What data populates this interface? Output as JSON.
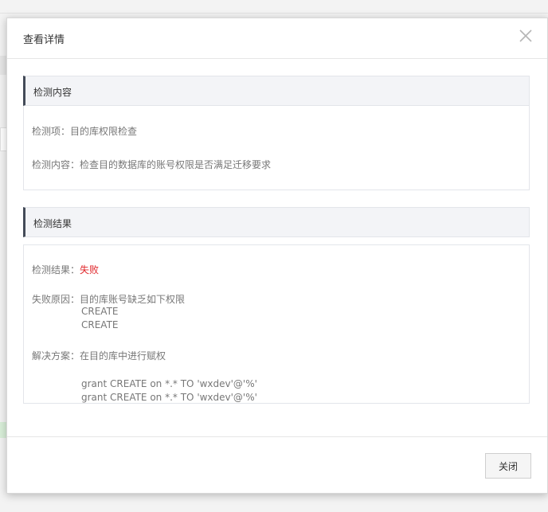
{
  "modal": {
    "title": "查看详情",
    "close_icon": "close-icon"
  },
  "check_content": {
    "heading": "检测内容",
    "item_label": "检测项：",
    "item_value": "目的库权限检查",
    "content_label": "检测内容：",
    "content_value": "检查目的数据库的账号权限是否满足迁移要求"
  },
  "check_result": {
    "heading": "检测结果",
    "result_label": "检测结果：",
    "result_value": "失败",
    "reason_label": "失败原因：",
    "reason_value": "目的库账号缺乏如下权限",
    "reason_items": [
      "CREATE",
      "CREATE"
    ],
    "solution_label": "解决方案：",
    "solution_value": "在目的库中进行赋权",
    "solution_commands": [
      "grant CREATE on *.* TO 'wxdev'@'%'",
      "grant CREATE on *.* TO 'wxdev'@'%'"
    ],
    "fail_color": "#e0262a"
  },
  "footer": {
    "close_label": "关闭"
  }
}
